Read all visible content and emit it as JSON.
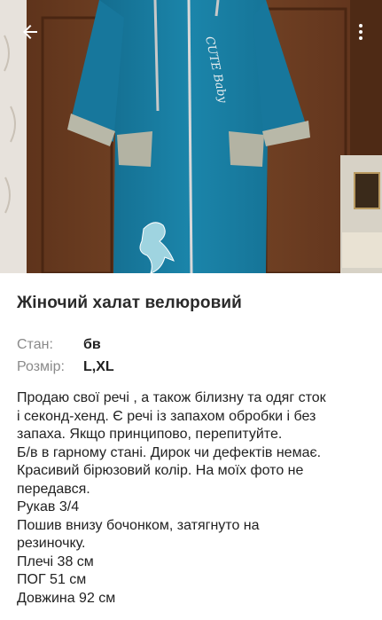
{
  "listing": {
    "title": "Жіночий халат велюровий",
    "image_alt": "turquoise velour robe photo",
    "params": [
      {
        "label": "Стан:",
        "value": "бв"
      },
      {
        "label": "Розмір:",
        "value": "L,XL"
      }
    ],
    "description_lines": [
      "Продаю свої речі , а також білизну та одяг сток",
      "і секонд-хенд. Є речі із запахом обробки і без",
      "запаха. Якщо принципово, перепитуйте.",
      "Б/в в гарному стані. Дирок чи дефектів немає.",
      "Красивий бірюзовий колір. На моїх фото не",
      "передався.",
      "Рукав 3/4",
      "Пошив внизу бочонком, затягнуто на",
      "резиночку.",
      "Плечі 38 см",
      "ПОГ 51 см",
      "Довжина 92 см"
    ],
    "robe_print_text": "CUTE Baby"
  },
  "toolbar": {
    "back_icon": "back-arrow-icon",
    "more_icon": "more-vert-icon"
  },
  "colors": {
    "robe": "#1a7fa3",
    "cuffs": "#b8b8a8",
    "wardrobe": "#6b3d22"
  }
}
